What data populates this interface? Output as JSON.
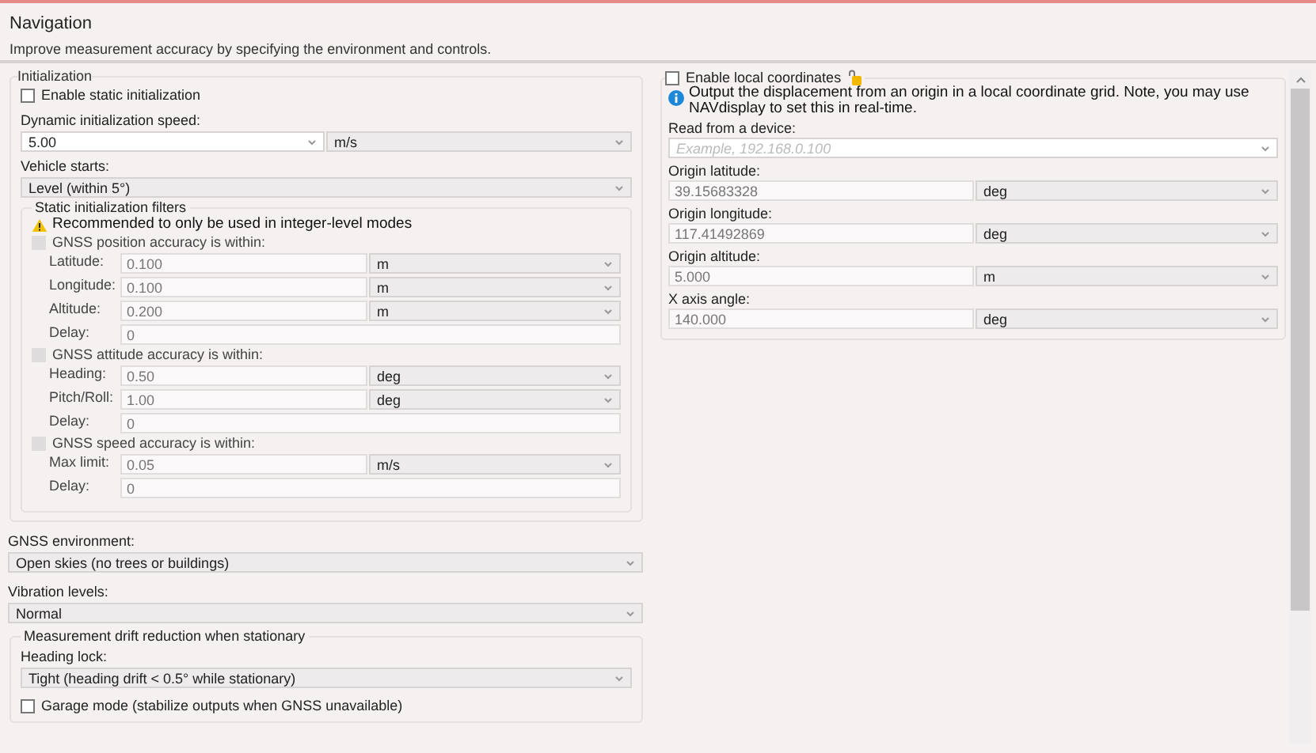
{
  "header": {
    "title": "Navigation",
    "subtitle": "Improve measurement accuracy by specifying the environment and controls."
  },
  "initialization": {
    "legend": "Initialization",
    "static_init": {
      "label": "Enable static initialization",
      "checked": false
    },
    "speed": {
      "label": "Dynamic initialization speed:",
      "value": "5.00",
      "unit": "m/s"
    },
    "vehicle_starts": {
      "label": "Vehicle starts:",
      "value": "Level (within 5°)"
    },
    "filters": {
      "legend": "Static initialization filters",
      "warning": "Recommended to only be used in integer-level modes",
      "groups": [
        {
          "label": "GNSS position accuracy is within:",
          "checked": false,
          "disabled": true,
          "rows": [
            {
              "label": "Latitude:",
              "value": "0.100",
              "unit": "m"
            },
            {
              "label": "Longitude:",
              "value": "0.100",
              "unit": "m"
            },
            {
              "label": "Altitude:",
              "value": "0.200",
              "unit": "m"
            },
            {
              "label": "Delay:",
              "value": "0"
            }
          ]
        },
        {
          "label": "GNSS attitude accuracy is within:",
          "checked": false,
          "disabled": true,
          "rows": [
            {
              "label": "Heading:",
              "value": "0.50",
              "unit": "deg"
            },
            {
              "label": "Pitch/Roll:",
              "value": "1.00",
              "unit": "deg"
            },
            {
              "label": "Delay:",
              "value": "0"
            }
          ]
        },
        {
          "label": "GNSS speed accuracy is within:",
          "checked": false,
          "disabled": true,
          "rows": [
            {
              "label": "Max limit:",
              "value": "0.05",
              "unit": "m/s"
            },
            {
              "label": "Delay:",
              "value": "0"
            }
          ]
        }
      ]
    }
  },
  "gnss_environment": {
    "label": "GNSS environment:",
    "value": "Open skies (no trees or buildings)"
  },
  "vibration": {
    "label": "Vibration levels:",
    "value": "Normal"
  },
  "drift": {
    "legend": "Measurement drift reduction when stationary",
    "heading_lock": {
      "label": "Heading lock:",
      "value": "Tight (heading drift < 0.5° while stationary)"
    },
    "garage_mode": {
      "label": "Garage mode (stabilize outputs when GNSS unavailable)",
      "checked": false
    }
  },
  "local_coordinates": {
    "label": "Enable local coordinates",
    "checked": false,
    "info": "Output the displacement from an origin in a local coordinate grid. Note, you may use NAVdisplay to set this in real-time.",
    "device": {
      "label": "Read from a device:",
      "placeholder": "Example, 192.168.0.100"
    },
    "fields": [
      {
        "label": "Origin latitude:",
        "value": "39.15683328",
        "unit": "deg"
      },
      {
        "label": "Origin longitude:",
        "value": "117.41492869",
        "unit": "deg"
      },
      {
        "label": "Origin altitude:",
        "value": "5.000",
        "unit": "m"
      },
      {
        "label": "X axis angle:",
        "value": "140.000",
        "unit": "deg"
      }
    ]
  }
}
